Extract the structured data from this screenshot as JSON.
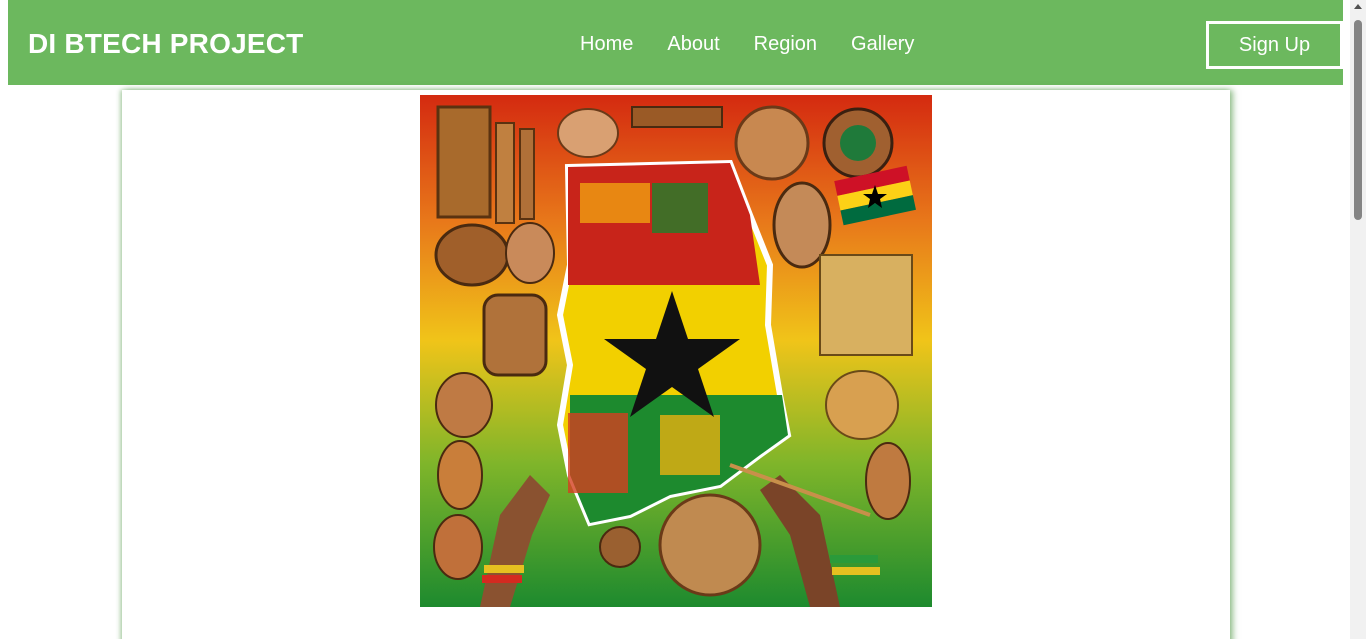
{
  "header": {
    "brand": "DI BTECH PROJECT",
    "nav": [
      {
        "label": "Home"
      },
      {
        "label": "About"
      },
      {
        "label": "Region"
      },
      {
        "label": "Gallery"
      }
    ],
    "signup_label": "Sign Up"
  },
  "colors": {
    "nav_bg": "#6cb85e",
    "nav_text": "#ffffff",
    "card_shadow": "#3c8c32"
  },
  "hero": {
    "icon": "ghana-culture-collage-image"
  }
}
